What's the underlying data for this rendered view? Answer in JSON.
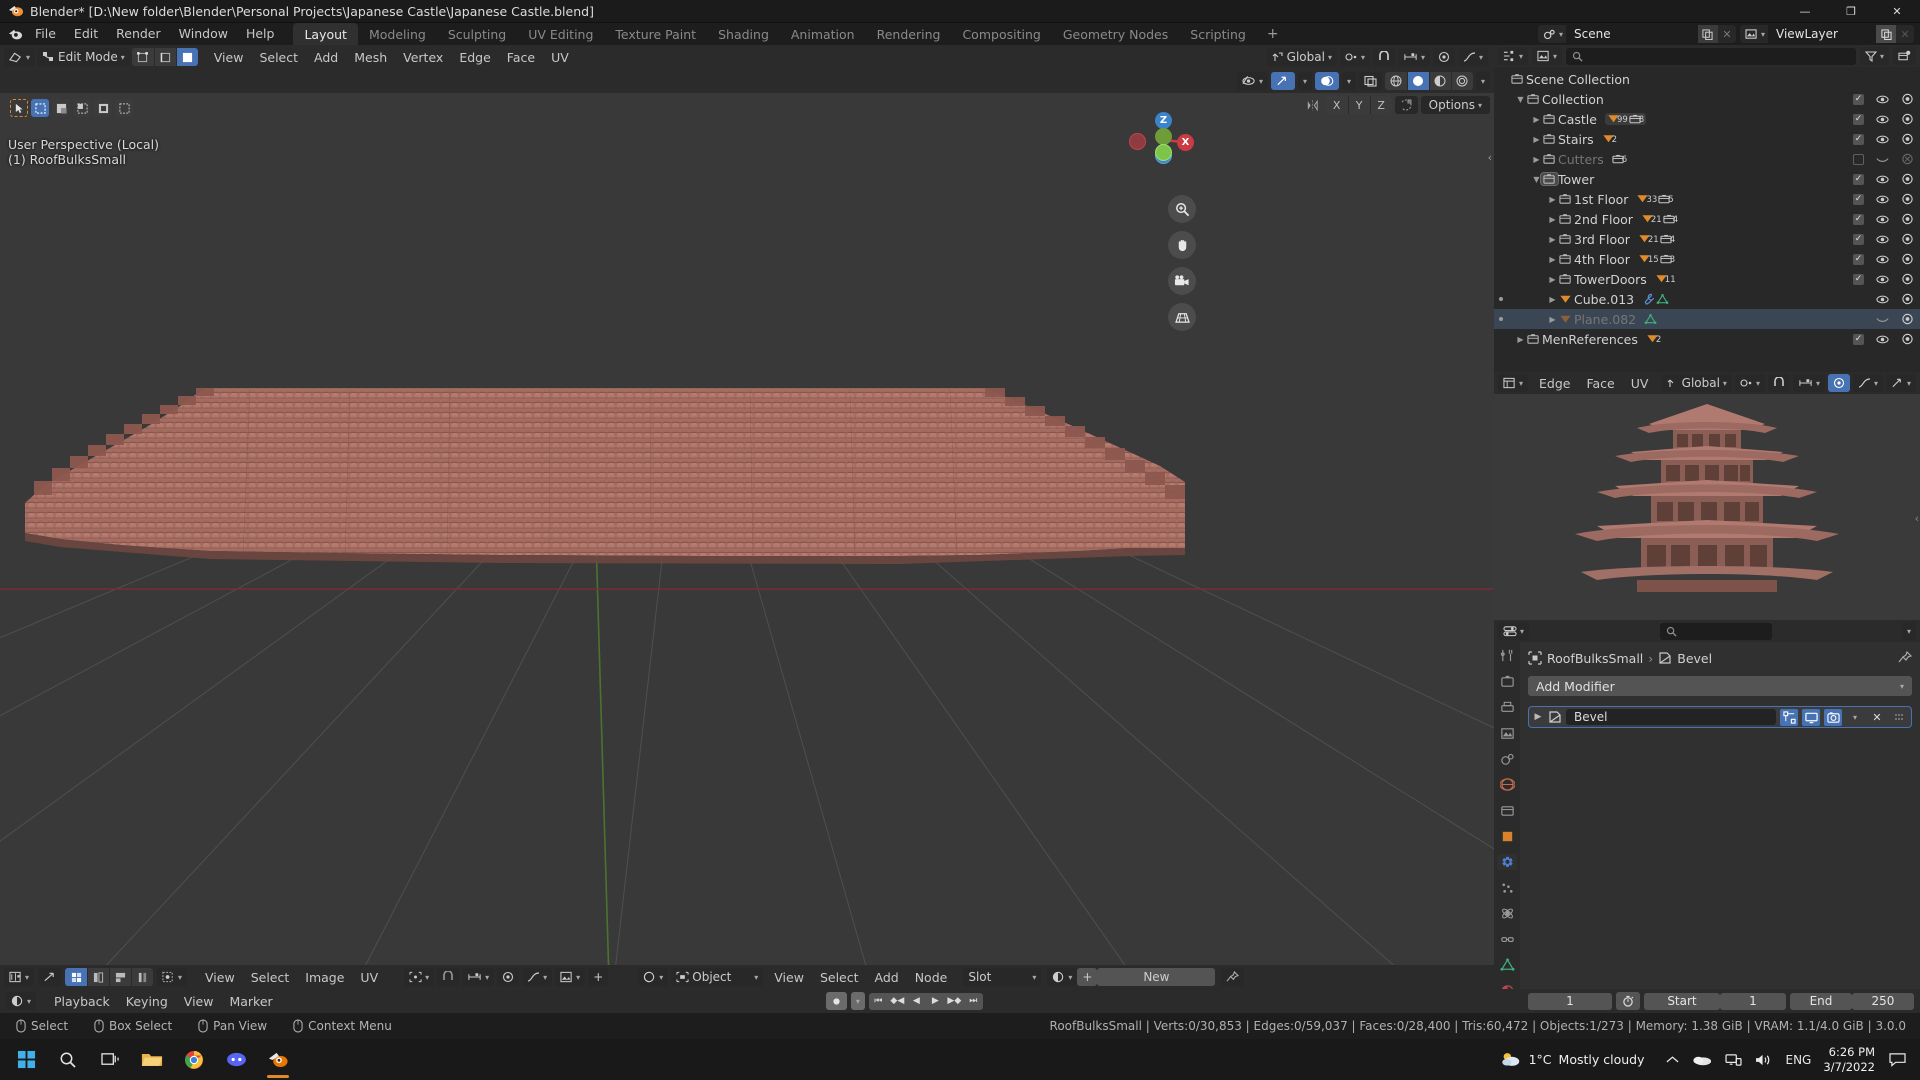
{
  "window": {
    "title": "Blender* [D:\\New folder\\Blender\\Personal Projects\\Japanese Castle\\Japanese Castle.blend]",
    "minimize": "—",
    "maximize": "❐",
    "close": "✕"
  },
  "topbar": {
    "menus": [
      "File",
      "Edit",
      "Render",
      "Window",
      "Help"
    ],
    "workspaces": [
      {
        "label": "Layout",
        "active": true
      },
      {
        "label": "Modeling",
        "active": false
      },
      {
        "label": "Sculpting",
        "active": false
      },
      {
        "label": "UV Editing",
        "active": false
      },
      {
        "label": "Texture Paint",
        "active": false
      },
      {
        "label": "Shading",
        "active": false
      },
      {
        "label": "Animation",
        "active": false
      },
      {
        "label": "Rendering",
        "active": false
      },
      {
        "label": "Compositing",
        "active": false
      },
      {
        "label": "Geometry Nodes",
        "active": false
      },
      {
        "label": "Scripting",
        "active": false
      }
    ],
    "add_workspace": "+",
    "scene_name": "Scene",
    "viewlayer_name": "ViewLayer"
  },
  "viewport": {
    "mode": "Edit Mode",
    "menus": [
      "View",
      "Select",
      "Add",
      "Mesh",
      "Vertex",
      "Edge",
      "Face",
      "UV"
    ],
    "transform_orientation": "Global",
    "options_label": "Options",
    "proportional_axes": [
      "X",
      "Y",
      "Z"
    ],
    "overlay_line1": "User Perspective (Local)",
    "overlay_line2": "(1) RoofBulksSmall",
    "gizmo_axes": {
      "x": "X",
      "y": "Y",
      "z": "Z"
    },
    "navigate": [
      "zoom-icon",
      "hand-icon",
      "camera-icon",
      "grid-icon"
    ]
  },
  "outliner": {
    "display_mode": "view-layer-icon",
    "search_placeholder": "",
    "root": "Scene Collection",
    "items": [
      {
        "label": "Collection",
        "indent": 1,
        "icon": "collection",
        "expanded": true,
        "disclosure": "down",
        "badges": [],
        "checkbox": true,
        "eye": true,
        "camera": true,
        "dim": false,
        "selected": false
      },
      {
        "label": "Castle",
        "indent": 2,
        "icon": "collection",
        "disclosure": "right",
        "badges": [
          {
            "type": "mesh",
            "count": "99"
          },
          {
            "type": "collection",
            "count": "8"
          }
        ],
        "checkbox": true,
        "eye": true,
        "camera": true,
        "dim": false,
        "selected": false,
        "badge_highlight": true
      },
      {
        "label": "Stairs",
        "indent": 2,
        "icon": "collection",
        "disclosure": "right",
        "badges": [
          {
            "type": "mesh",
            "count": "2"
          }
        ],
        "checkbox": true,
        "eye": true,
        "camera": true,
        "dim": false,
        "selected": false
      },
      {
        "label": "Cutters",
        "indent": 2,
        "icon": "collection",
        "disclosure": "right",
        "badges": [
          {
            "type": "collection",
            "count": "6"
          }
        ],
        "checkbox": false,
        "eye": false,
        "camera": false,
        "dim": true,
        "selected": false
      },
      {
        "label": "Tower",
        "indent": 2,
        "icon": "collection",
        "disclosure": "down",
        "badges": [],
        "checkbox": true,
        "eye": true,
        "camera": true,
        "dim": false,
        "selected": false,
        "icon_highlight": true
      },
      {
        "label": "1st Floor",
        "indent": 3,
        "icon": "collection",
        "disclosure": "right",
        "badges": [
          {
            "type": "mesh",
            "count": "33"
          },
          {
            "type": "collection",
            "count": "5"
          }
        ],
        "checkbox": true,
        "eye": true,
        "camera": true,
        "dim": false,
        "selected": false
      },
      {
        "label": "2nd Floor",
        "indent": 3,
        "icon": "collection",
        "disclosure": "right",
        "badges": [
          {
            "type": "mesh",
            "count": "21"
          },
          {
            "type": "collection",
            "count": "4"
          }
        ],
        "checkbox": true,
        "eye": true,
        "camera": true,
        "dim": false,
        "selected": false
      },
      {
        "label": "3rd Floor",
        "indent": 3,
        "icon": "collection",
        "disclosure": "right",
        "badges": [
          {
            "type": "mesh",
            "count": "21"
          },
          {
            "type": "collection",
            "count": "4"
          }
        ],
        "checkbox": true,
        "eye": true,
        "camera": true,
        "dim": false,
        "selected": false
      },
      {
        "label": "4th Floor",
        "indent": 3,
        "icon": "collection",
        "disclosure": "right",
        "badges": [
          {
            "type": "mesh",
            "count": "15"
          },
          {
            "type": "collection",
            "count": "3"
          }
        ],
        "checkbox": true,
        "eye": true,
        "camera": true,
        "dim": false,
        "selected": false
      },
      {
        "label": "TowerDoors",
        "indent": 3,
        "icon": "collection",
        "disclosure": "right",
        "badges": [
          {
            "type": "mesh",
            "count": "11"
          }
        ],
        "checkbox": true,
        "eye": true,
        "camera": true,
        "dim": false,
        "selected": false
      },
      {
        "label": "Cube.013",
        "indent": 3,
        "icon": "mesh",
        "disclosure": "right",
        "badges": [
          {
            "type": "wrench",
            "count": ""
          },
          {
            "type": "data",
            "count": ""
          }
        ],
        "checkbox": null,
        "eye": true,
        "camera": true,
        "dim": false,
        "selected": false,
        "dot": true
      },
      {
        "label": "Plane.082",
        "indent": 3,
        "icon": "mesh",
        "disclosure": "right",
        "badges": [
          {
            "type": "data",
            "count": ""
          }
        ],
        "checkbox": null,
        "eye": false,
        "camera": true,
        "dim": true,
        "selected": true,
        "dot": true
      },
      {
        "label": "MenReferences",
        "indent": 1,
        "icon": "collection",
        "disclosure": "right",
        "badges": [
          {
            "type": "mesh",
            "count": "2"
          }
        ],
        "checkbox": true,
        "eye": true,
        "camera": true,
        "dim": false,
        "selected": false
      }
    ]
  },
  "uv_preview": {
    "header_menus": [
      "Edge",
      "Face",
      "UV"
    ],
    "orientation": "Global"
  },
  "properties": {
    "search_placeholder": "",
    "breadcrumb_object": "RoofBulksSmall",
    "breadcrumb_modifier": "Bevel",
    "add_modifier_label": "Add Modifier",
    "modifiers": [
      {
        "name": "Bevel",
        "toggles": [
          "edit-mode-display-icon",
          "realtime-display-icon",
          "render-display-icon"
        ],
        "dropdown": "chevron-down-icon",
        "close": "close-icon",
        "drag": "drag-handle-icon"
      }
    ]
  },
  "bottom_editors": {
    "uv_header_menus": [
      "View",
      "Select",
      "Image",
      "UV"
    ],
    "node_mode": "Object",
    "node_menus": [
      "View",
      "Select",
      "Add",
      "Node"
    ],
    "slot_label": "Slot",
    "new_label": "New",
    "timeline_menus": [
      "Playback",
      "Keying",
      "View",
      "Marker"
    ],
    "current_frame": "1",
    "start_label": "Start",
    "start_frame": "1",
    "end_label": "End",
    "end_frame": "250"
  },
  "statusbar": {
    "hints": [
      {
        "icon": "mouse-left-icon",
        "label": "Select"
      },
      {
        "icon": "mouse-drag-icon",
        "label": "Box Select"
      },
      {
        "icon": "mouse-middle-icon",
        "label": "Pan View"
      },
      {
        "icon": "mouse-right-icon",
        "label": "Context Menu"
      }
    ],
    "stats": "RoofBulksSmall | Verts:0/30,853 | Edges:0/59,037 | Faces:0/28,400 | Tris:60,472 | Objects:1/273 | Memory: 1.38 GiB | VRAM: 1.1/4.0 GiB | 3.0.0"
  },
  "taskbar": {
    "apps": [
      "start-icon",
      "search-icon",
      "taskview-icon",
      "explorer-icon",
      "chrome-icon",
      "discord-icon",
      "blender-icon"
    ],
    "weather_temp": "1°C",
    "weather_desc": "Mostly cloudy",
    "language": "ENG",
    "time": "6:26 PM",
    "date": "3/7/2022"
  },
  "colors": {
    "accent_blue": "#4772b3",
    "orange": "#e08a2a",
    "axis_x": "#cc3a42",
    "axis_y": "#7cc44a",
    "axis_z": "#3a84cc",
    "roof": "#b07268",
    "bg_dark": "#1d1d1d",
    "panel": "#303030",
    "viewport": "#393939"
  }
}
